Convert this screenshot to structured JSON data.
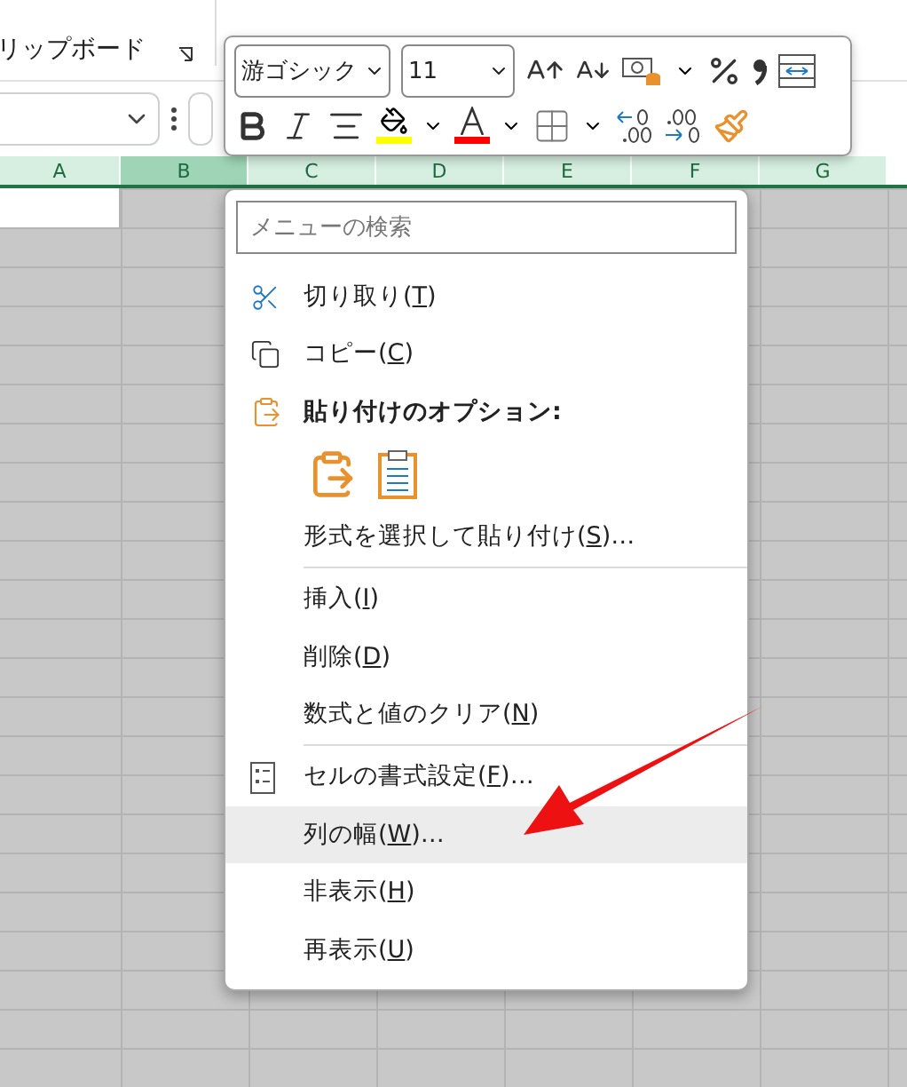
{
  "ribbon": {
    "group_label": "リップボード"
  },
  "mini_toolbar": {
    "font": "游ゴシック",
    "size": "11"
  },
  "column_headers": [
    {
      "label": "A",
      "selected": false
    },
    {
      "label": "B",
      "selected": true
    },
    {
      "label": "C",
      "selected": false
    },
    {
      "label": "D",
      "selected": false
    },
    {
      "label": "E",
      "selected": false
    },
    {
      "label": "F",
      "selected": false
    },
    {
      "label": "G",
      "selected": false
    }
  ],
  "menu": {
    "search_placeholder": "メニューの検索",
    "items": [
      {
        "kind": "cut",
        "before": "切り取り(",
        "key": "T",
        "after": ")",
        "selected": false
      },
      {
        "kind": "copy",
        "before": "コピー(",
        "key": "C",
        "after": ")",
        "selected": false
      },
      {
        "kind": "paste-header",
        "before": "貼り付けのオプション:",
        "selected": false
      },
      {
        "kind": "paste-buttons"
      },
      {
        "kind": "command",
        "before": "形式を選択して貼り付け(",
        "key": "S",
        "after": ")…",
        "selected": false
      },
      {
        "kind": "separator"
      },
      {
        "kind": "command",
        "before": "挿入(",
        "key": "I",
        "after": ")",
        "selected": false
      },
      {
        "kind": "command",
        "before": "削除(",
        "key": "D",
        "after": ")",
        "selected": false
      },
      {
        "kind": "command",
        "before": "数式と値のクリア(",
        "key": "N",
        "after": ")",
        "selected": false
      },
      {
        "kind": "separator"
      },
      {
        "kind": "format",
        "before": "セルの書式設定(",
        "key": "F",
        "after": ")…",
        "selected": false
      },
      {
        "kind": "command",
        "before": "列の幅(",
        "key": "W",
        "after": ")…",
        "selected": true
      },
      {
        "kind": "command",
        "before": "非表示(",
        "key": "H",
        "after": ")",
        "selected": false
      },
      {
        "kind": "command",
        "before": "再表示(",
        "key": "U",
        "after": ")",
        "selected": false
      }
    ]
  }
}
